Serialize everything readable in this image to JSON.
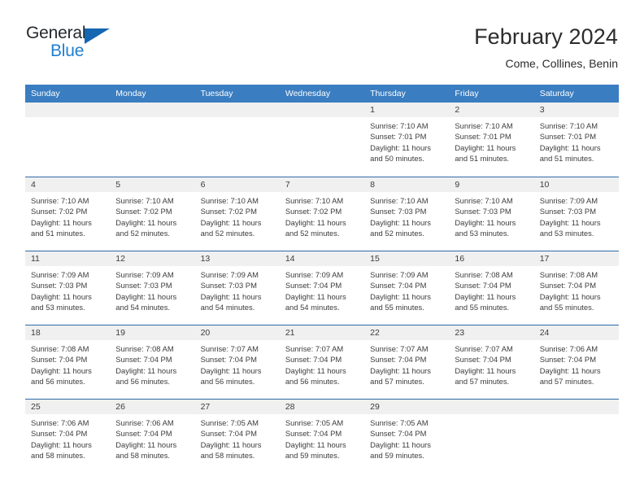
{
  "logo": {
    "word_top": "General",
    "word_bottom": "Blue",
    "triangle_icon": "triangle-icon",
    "color_dark": "#24292e",
    "color_blue": "#1f7fd1"
  },
  "header": {
    "title": "February 2024",
    "subtitle": "Come, Collines, Benin"
  },
  "theme": {
    "header_row_bg": "#3a7dc0",
    "week_separator": "#2f6aa8",
    "daynum_band_bg": "#f0f0f0",
    "text": "#3c3c3c"
  },
  "calendar": {
    "weekday_headers": [
      "Sunday",
      "Monday",
      "Tuesday",
      "Wednesday",
      "Thursday",
      "Friday",
      "Saturday"
    ],
    "weeks": [
      [
        {
          "day": "",
          "sunrise": "",
          "sunset": "",
          "daylight_1": "",
          "daylight_2": ""
        },
        {
          "day": "",
          "sunrise": "",
          "sunset": "",
          "daylight_1": "",
          "daylight_2": ""
        },
        {
          "day": "",
          "sunrise": "",
          "sunset": "",
          "daylight_1": "",
          "daylight_2": ""
        },
        {
          "day": "",
          "sunrise": "",
          "sunset": "",
          "daylight_1": "",
          "daylight_2": ""
        },
        {
          "day": "1",
          "sunrise": "Sunrise: 7:10 AM",
          "sunset": "Sunset: 7:01 PM",
          "daylight_1": "Daylight: 11 hours",
          "daylight_2": "and 50 minutes."
        },
        {
          "day": "2",
          "sunrise": "Sunrise: 7:10 AM",
          "sunset": "Sunset: 7:01 PM",
          "daylight_1": "Daylight: 11 hours",
          "daylight_2": "and 51 minutes."
        },
        {
          "day": "3",
          "sunrise": "Sunrise: 7:10 AM",
          "sunset": "Sunset: 7:01 PM",
          "daylight_1": "Daylight: 11 hours",
          "daylight_2": "and 51 minutes."
        }
      ],
      [
        {
          "day": "4",
          "sunrise": "Sunrise: 7:10 AM",
          "sunset": "Sunset: 7:02 PM",
          "daylight_1": "Daylight: 11 hours",
          "daylight_2": "and 51 minutes."
        },
        {
          "day": "5",
          "sunrise": "Sunrise: 7:10 AM",
          "sunset": "Sunset: 7:02 PM",
          "daylight_1": "Daylight: 11 hours",
          "daylight_2": "and 52 minutes."
        },
        {
          "day": "6",
          "sunrise": "Sunrise: 7:10 AM",
          "sunset": "Sunset: 7:02 PM",
          "daylight_1": "Daylight: 11 hours",
          "daylight_2": "and 52 minutes."
        },
        {
          "day": "7",
          "sunrise": "Sunrise: 7:10 AM",
          "sunset": "Sunset: 7:02 PM",
          "daylight_1": "Daylight: 11 hours",
          "daylight_2": "and 52 minutes."
        },
        {
          "day": "8",
          "sunrise": "Sunrise: 7:10 AM",
          "sunset": "Sunset: 7:03 PM",
          "daylight_1": "Daylight: 11 hours",
          "daylight_2": "and 52 minutes."
        },
        {
          "day": "9",
          "sunrise": "Sunrise: 7:10 AM",
          "sunset": "Sunset: 7:03 PM",
          "daylight_1": "Daylight: 11 hours",
          "daylight_2": "and 53 minutes."
        },
        {
          "day": "10",
          "sunrise": "Sunrise: 7:09 AM",
          "sunset": "Sunset: 7:03 PM",
          "daylight_1": "Daylight: 11 hours",
          "daylight_2": "and 53 minutes."
        }
      ],
      [
        {
          "day": "11",
          "sunrise": "Sunrise: 7:09 AM",
          "sunset": "Sunset: 7:03 PM",
          "daylight_1": "Daylight: 11 hours",
          "daylight_2": "and 53 minutes."
        },
        {
          "day": "12",
          "sunrise": "Sunrise: 7:09 AM",
          "sunset": "Sunset: 7:03 PM",
          "daylight_1": "Daylight: 11 hours",
          "daylight_2": "and 54 minutes."
        },
        {
          "day": "13",
          "sunrise": "Sunrise: 7:09 AM",
          "sunset": "Sunset: 7:03 PM",
          "daylight_1": "Daylight: 11 hours",
          "daylight_2": "and 54 minutes."
        },
        {
          "day": "14",
          "sunrise": "Sunrise: 7:09 AM",
          "sunset": "Sunset: 7:04 PM",
          "daylight_1": "Daylight: 11 hours",
          "daylight_2": "and 54 minutes."
        },
        {
          "day": "15",
          "sunrise": "Sunrise: 7:09 AM",
          "sunset": "Sunset: 7:04 PM",
          "daylight_1": "Daylight: 11 hours",
          "daylight_2": "and 55 minutes."
        },
        {
          "day": "16",
          "sunrise": "Sunrise: 7:08 AM",
          "sunset": "Sunset: 7:04 PM",
          "daylight_1": "Daylight: 11 hours",
          "daylight_2": "and 55 minutes."
        },
        {
          "day": "17",
          "sunrise": "Sunrise: 7:08 AM",
          "sunset": "Sunset: 7:04 PM",
          "daylight_1": "Daylight: 11 hours",
          "daylight_2": "and 55 minutes."
        }
      ],
      [
        {
          "day": "18",
          "sunrise": "Sunrise: 7:08 AM",
          "sunset": "Sunset: 7:04 PM",
          "daylight_1": "Daylight: 11 hours",
          "daylight_2": "and 56 minutes."
        },
        {
          "day": "19",
          "sunrise": "Sunrise: 7:08 AM",
          "sunset": "Sunset: 7:04 PM",
          "daylight_1": "Daylight: 11 hours",
          "daylight_2": "and 56 minutes."
        },
        {
          "day": "20",
          "sunrise": "Sunrise: 7:07 AM",
          "sunset": "Sunset: 7:04 PM",
          "daylight_1": "Daylight: 11 hours",
          "daylight_2": "and 56 minutes."
        },
        {
          "day": "21",
          "sunrise": "Sunrise: 7:07 AM",
          "sunset": "Sunset: 7:04 PM",
          "daylight_1": "Daylight: 11 hours",
          "daylight_2": "and 56 minutes."
        },
        {
          "day": "22",
          "sunrise": "Sunrise: 7:07 AM",
          "sunset": "Sunset: 7:04 PM",
          "daylight_1": "Daylight: 11 hours",
          "daylight_2": "and 57 minutes."
        },
        {
          "day": "23",
          "sunrise": "Sunrise: 7:07 AM",
          "sunset": "Sunset: 7:04 PM",
          "daylight_1": "Daylight: 11 hours",
          "daylight_2": "and 57 minutes."
        },
        {
          "day": "24",
          "sunrise": "Sunrise: 7:06 AM",
          "sunset": "Sunset: 7:04 PM",
          "daylight_1": "Daylight: 11 hours",
          "daylight_2": "and 57 minutes."
        }
      ],
      [
        {
          "day": "25",
          "sunrise": "Sunrise: 7:06 AM",
          "sunset": "Sunset: 7:04 PM",
          "daylight_1": "Daylight: 11 hours",
          "daylight_2": "and 58 minutes."
        },
        {
          "day": "26",
          "sunrise": "Sunrise: 7:06 AM",
          "sunset": "Sunset: 7:04 PM",
          "daylight_1": "Daylight: 11 hours",
          "daylight_2": "and 58 minutes."
        },
        {
          "day": "27",
          "sunrise": "Sunrise: 7:05 AM",
          "sunset": "Sunset: 7:04 PM",
          "daylight_1": "Daylight: 11 hours",
          "daylight_2": "and 58 minutes."
        },
        {
          "day": "28",
          "sunrise": "Sunrise: 7:05 AM",
          "sunset": "Sunset: 7:04 PM",
          "daylight_1": "Daylight: 11 hours",
          "daylight_2": "and 59 minutes."
        },
        {
          "day": "29",
          "sunrise": "Sunrise: 7:05 AM",
          "sunset": "Sunset: 7:04 PM",
          "daylight_1": "Daylight: 11 hours",
          "daylight_2": "and 59 minutes."
        },
        {
          "day": "",
          "sunrise": "",
          "sunset": "",
          "daylight_1": "",
          "daylight_2": ""
        },
        {
          "day": "",
          "sunrise": "",
          "sunset": "",
          "daylight_1": "",
          "daylight_2": ""
        }
      ]
    ]
  }
}
